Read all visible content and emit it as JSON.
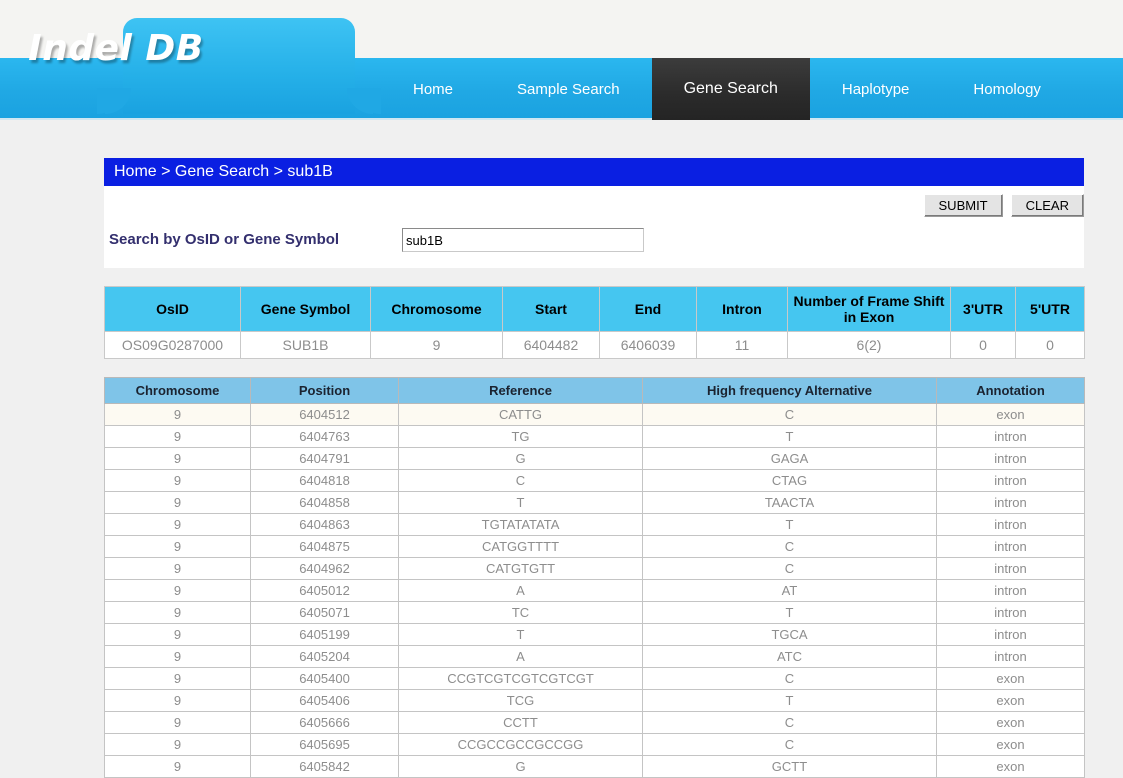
{
  "site": {
    "logo_text": "Indel DB"
  },
  "nav": {
    "items": [
      {
        "label": "Home",
        "active": false
      },
      {
        "label": "Sample Search",
        "active": false
      },
      {
        "label": "Gene Search",
        "active": true
      },
      {
        "label": "Haplotype",
        "active": false
      },
      {
        "label": "Homology",
        "active": false
      }
    ]
  },
  "breadcrumb": {
    "text": "Home > Gene Search > sub1B"
  },
  "search": {
    "label": "Search by OsID or Gene Symbol",
    "value": "sub1B",
    "placeholder": "",
    "submit_label": "SUBMIT",
    "clear_label": "CLEAR"
  },
  "gene_table": {
    "headers": [
      "OsID",
      "Gene Symbol",
      "Chromosome",
      "Start",
      "End",
      "Intron",
      "Number of Frame Shift in Exon",
      "3'UTR",
      "5'UTR"
    ],
    "rows": [
      [
        "OS09G0287000",
        "SUB1B",
        "9",
        "6404482",
        "6406039",
        "11",
        "6(2)",
        "0",
        "0"
      ]
    ]
  },
  "variant_table": {
    "headers": [
      "Chromosome",
      "Position",
      "Reference",
      "High frequency Alternative",
      "Annotation"
    ],
    "rows": [
      [
        "9",
        "6404512",
        "CATTG",
        "C",
        "exon"
      ],
      [
        "9",
        "6404763",
        "TG",
        "T",
        "intron"
      ],
      [
        "9",
        "6404791",
        "G",
        "GAGA",
        "intron"
      ],
      [
        "9",
        "6404818",
        "C",
        "CTAG",
        "intron"
      ],
      [
        "9",
        "6404858",
        "T",
        "TAACTA",
        "intron"
      ],
      [
        "9",
        "6404863",
        "TGTATATATA",
        "T",
        "intron"
      ],
      [
        "9",
        "6404875",
        "CATGGTTTT",
        "C",
        "intron"
      ],
      [
        "9",
        "6404962",
        "CATGTGTT",
        "C",
        "intron"
      ],
      [
        "9",
        "6405012",
        "A",
        "AT",
        "intron"
      ],
      [
        "9",
        "6405071",
        "TC",
        "T",
        "intron"
      ],
      [
        "9",
        "6405199",
        "T",
        "TGCA",
        "intron"
      ],
      [
        "9",
        "6405204",
        "A",
        "ATC",
        "intron"
      ],
      [
        "9",
        "6405400",
        "CCGTCGTCGTCGTCGT",
        "C",
        "exon"
      ],
      [
        "9",
        "6405406",
        "TCG",
        "T",
        "exon"
      ],
      [
        "9",
        "6405666",
        "CCTT",
        "C",
        "exon"
      ],
      [
        "9",
        "6405695",
        "CCGCCGCCGCCGG",
        "C",
        "exon"
      ],
      [
        "9",
        "6405842",
        "G",
        "GCTT",
        "exon"
      ]
    ]
  },
  "colors": {
    "nav_blue": "#20a8e4",
    "active_tab": "#2b2b2b",
    "breadcrumb_blue": "#0a1fe2",
    "gene_header_cyan": "#45c6f0",
    "variant_header_blue": "#7fc4e8",
    "page_background": "#f0f0f0",
    "label_navy": "#332f6e"
  }
}
